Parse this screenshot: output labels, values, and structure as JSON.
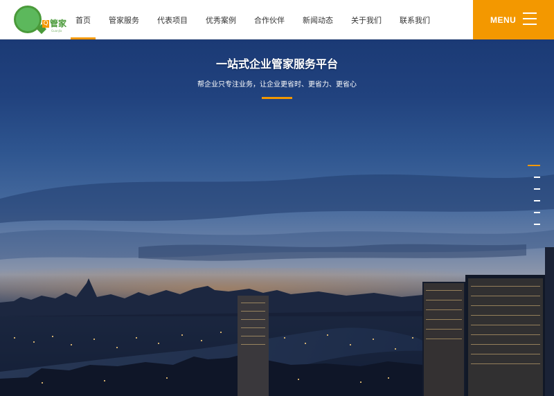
{
  "header": {
    "logo": {
      "badge": "Q",
      "brand": "管家",
      "brand_sub": "GuanJia"
    },
    "nav": [
      {
        "label": "首页",
        "active": true
      },
      {
        "label": "管家服务"
      },
      {
        "label": "代表项目"
      },
      {
        "label": "优秀案例"
      },
      {
        "label": "合作伙伴"
      },
      {
        "label": "新闻动态"
      },
      {
        "label": "关于我们"
      },
      {
        "label": "联系我们"
      }
    ],
    "menu": {
      "label": "MENU"
    }
  },
  "hero": {
    "title": "一站式企业管家服务平台",
    "subtitle": "帮企业只专注业务，让企业更省时、更省力、更省心",
    "slides": {
      "count": 6,
      "active": 1
    }
  },
  "colors": {
    "accent": "#f39800",
    "logo_green": "#5cb85c",
    "nav_text": "#333333"
  }
}
